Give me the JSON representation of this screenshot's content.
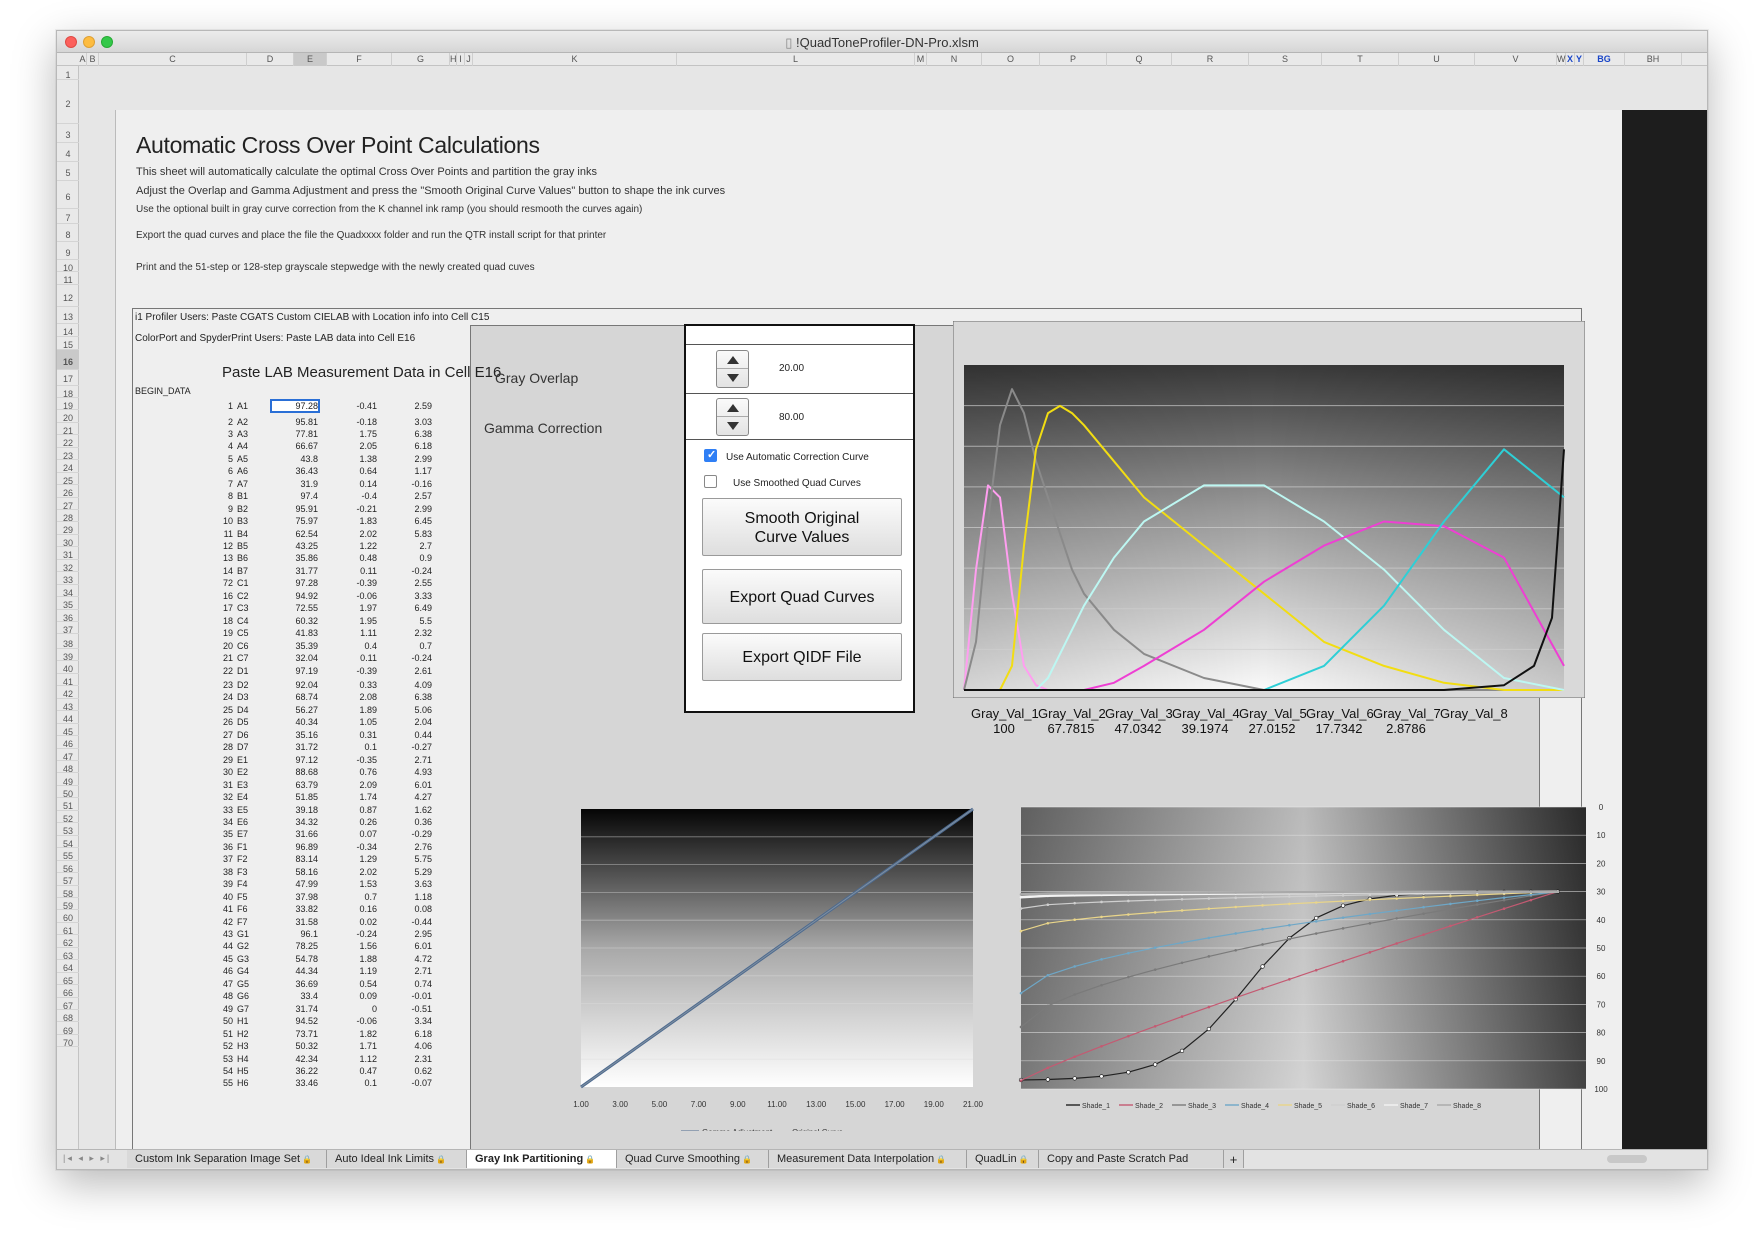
{
  "window": {
    "title": "!QuadToneProfiler-DN-Pro.xlsm"
  },
  "columns": [
    "A",
    "B",
    "C",
    "D",
    "E",
    "F",
    "G",
    "H",
    "I",
    "J",
    "K",
    "L",
    "M",
    "N",
    "O",
    "P",
    "Q",
    "R",
    "S",
    "T",
    "U",
    "V",
    "W",
    "X",
    "Y",
    "BG",
    "BH"
  ],
  "rows": [
    "1",
    "2",
    "3",
    "4",
    "5",
    "6",
    "7",
    "8",
    "9",
    "10",
    "11",
    "12",
    "13",
    "14",
    "15",
    "16",
    "17",
    "18",
    "19",
    "20",
    "21",
    "22",
    "23",
    "24",
    "25",
    "26",
    "27",
    "28",
    "29",
    "30",
    "31",
    "32",
    "33",
    "34",
    "35",
    "36",
    "37",
    "38",
    "39",
    "40",
    "41",
    "42",
    "43",
    "44",
    "45",
    "46",
    "47",
    "48",
    "49",
    "50",
    "51",
    "52",
    "53",
    "54",
    "55",
    "56",
    "57",
    "58",
    "59",
    "60",
    "61",
    "62",
    "63",
    "64",
    "65",
    "66",
    "67",
    "68",
    "69",
    "70"
  ],
  "page": {
    "title": "Automatic Cross Over Point Calculations",
    "lines": [
      "This sheet will automatically calculate the optimal Cross Over Points and partition the gray inks",
      "Adjust the Overlap and Gamma Adjustment and press the \"Smooth Original Curve Values\" button to shape the ink curves",
      "Use the optional built in gray curve correction from the K channel ink ramp (you should resmooth the curves again)",
      "Export the quad curves and place the file the Quadxxxx folder and run the QTR install script for that printer",
      "Print and the 51-step or 128-step grayscale stepwedge with the newly created quad cuves"
    ],
    "i1_note": "i1 Profiler Users: Paste CGATS Custom CIELAB with Location info into Cell C15",
    "colorport_note": "ColorPort and SpyderPrint Users: Paste LAB data into Cell E16",
    "paste_header": "Paste LAB Measurement Data in Cell E16",
    "begin_data": "BEGIN_DATA"
  },
  "lab_data": [
    [
      "1",
      "A1",
      "97.28",
      "-0.41",
      "2.59"
    ],
    [
      "2",
      "A2",
      "95.81",
      "-0.18",
      "3.03"
    ],
    [
      "3",
      "A3",
      "77.81",
      "1.75",
      "6.38"
    ],
    [
      "4",
      "A4",
      "66.67",
      "2.05",
      "6.18"
    ],
    [
      "5",
      "A5",
      "43.8",
      "1.38",
      "2.99"
    ],
    [
      "6",
      "A6",
      "36.43",
      "0.64",
      "1.17"
    ],
    [
      "7",
      "A7",
      "31.9",
      "0.14",
      "-0.16"
    ],
    [
      "8",
      "B1",
      "97.4",
      "-0.4",
      "2.57"
    ],
    [
      "9",
      "B2",
      "95.91",
      "-0.21",
      "2.99"
    ],
    [
      "10",
      "B3",
      "75.97",
      "1.83",
      "6.45"
    ],
    [
      "11",
      "B4",
      "62.54",
      "2.02",
      "5.83"
    ],
    [
      "12",
      "B5",
      "43.25",
      "1.22",
      "2.7"
    ],
    [
      "13",
      "B6",
      "35.86",
      "0.48",
      "0.9"
    ],
    [
      "14",
      "B7",
      "31.77",
      "0.11",
      "-0.24"
    ],
    [
      "72",
      "C1",
      "97.28",
      "-0.39",
      "2.55"
    ],
    [
      "16",
      "C2",
      "94.92",
      "-0.06",
      "3.33"
    ],
    [
      "17",
      "C3",
      "72.55",
      "1.97",
      "6.49"
    ],
    [
      "18",
      "C4",
      "60.32",
      "1.95",
      "5.5"
    ],
    [
      "19",
      "C5",
      "41.83",
      "1.11",
      "2.32"
    ],
    [
      "20",
      "C6",
      "35.39",
      "0.4",
      "0.7"
    ],
    [
      "21",
      "C7",
      "32.04",
      "0.11",
      "-0.24"
    ],
    [
      "22",
      "D1",
      "97.19",
      "-0.39",
      "2.61"
    ],
    [
      "23",
      "D2",
      "92.04",
      "0.33",
      "4.09"
    ],
    [
      "24",
      "D3",
      "68.74",
      "2.08",
      "6.38"
    ],
    [
      "25",
      "D4",
      "56.27",
      "1.89",
      "5.06"
    ],
    [
      "26",
      "D5",
      "40.34",
      "1.05",
      "2.04"
    ],
    [
      "27",
      "D6",
      "35.16",
      "0.31",
      "0.44"
    ],
    [
      "28",
      "D7",
      "31.72",
      "0.1",
      "-0.27"
    ],
    [
      "29",
      "E1",
      "97.12",
      "-0.35",
      "2.71"
    ],
    [
      "30",
      "E2",
      "88.68",
      "0.76",
      "4.93"
    ],
    [
      "31",
      "E3",
      "63.79",
      "2.09",
      "6.01"
    ],
    [
      "32",
      "E4",
      "51.85",
      "1.74",
      "4.27"
    ],
    [
      "33",
      "E5",
      "39.18",
      "0.87",
      "1.62"
    ],
    [
      "34",
      "E6",
      "34.32",
      "0.26",
      "0.36"
    ],
    [
      "35",
      "E7",
      "31.66",
      "0.07",
      "-0.29"
    ],
    [
      "36",
      "F1",
      "96.89",
      "-0.34",
      "2.76"
    ],
    [
      "37",
      "F2",
      "83.14",
      "1.29",
      "5.75"
    ],
    [
      "38",
      "F3",
      "58.16",
      "2.02",
      "5.29"
    ],
    [
      "39",
      "F4",
      "47.99",
      "1.53",
      "3.63"
    ],
    [
      "40",
      "F5",
      "37.98",
      "0.7",
      "1.18"
    ],
    [
      "41",
      "F6",
      "33.82",
      "0.16",
      "0.08"
    ],
    [
      "42",
      "F7",
      "31.58",
      "0.02",
      "-0.44"
    ],
    [
      "43",
      "G1",
      "96.1",
      "-0.24",
      "2.95"
    ],
    [
      "44",
      "G2",
      "78.25",
      "1.56",
      "6.01"
    ],
    [
      "45",
      "G3",
      "54.78",
      "1.88",
      "4.72"
    ],
    [
      "46",
      "G4",
      "44.34",
      "1.19",
      "2.71"
    ],
    [
      "47",
      "G5",
      "36.69",
      "0.54",
      "0.74"
    ],
    [
      "48",
      "G6",
      "33.4",
      "0.09",
      "-0.01"
    ],
    [
      "49",
      "G7",
      "31.74",
      "0",
      "-0.51"
    ],
    [
      "50",
      "H1",
      "94.52",
      "-0.06",
      "3.34"
    ],
    [
      "51",
      "H2",
      "73.71",
      "1.82",
      "6.18"
    ],
    [
      "52",
      "H3",
      "50.32",
      "1.71",
      "4.06"
    ],
    [
      "53",
      "H4",
      "42.34",
      "1.12",
      "2.31"
    ],
    [
      "54",
      "H5",
      "36.22",
      "0.47",
      "0.62"
    ],
    [
      "55",
      "H6",
      "33.46",
      "0.1",
      "-0.07"
    ]
  ],
  "controls": {
    "gray_overlap_label": "Gray Overlap",
    "gray_overlap_value": "20.00",
    "gamma_label": "Gamma Correction",
    "gamma_value": "80.00",
    "auto_curve_label": "Use Automatic Correction Curve",
    "auto_curve_checked": true,
    "smoothed_label": "Use Smoothed Quad Curves",
    "smoothed_checked": false,
    "smooth_btn_line1": "Smooth Original",
    "smooth_btn_line2": "Curve Values",
    "export_quad_btn": "Export Quad Curves",
    "export_qidf_btn": "Export QIDF File"
  },
  "gray_vals": [
    {
      "name": "Gray_Val_1",
      "value": "100"
    },
    {
      "name": "Gray_Val_2",
      "value": "67.7815"
    },
    {
      "name": "Gray_Val_3",
      "value": "47.0342"
    },
    {
      "name": "Gray_Val_4",
      "value": "39.1974"
    },
    {
      "name": "Gray_Val_5",
      "value": "27.0152"
    },
    {
      "name": "Gray_Val_6",
      "value": "17.7342"
    },
    {
      "name": "Gray_Val_7",
      "value": "2.8786"
    },
    {
      "name": "Gray_Val_8",
      "value": ""
    }
  ],
  "chart_data": [
    {
      "type": "line",
      "title": "",
      "xlabel": "",
      "ylabel": "",
      "series": [
        {
          "color": "#ff9ef0",
          "x": [
            0,
            2,
            4,
            6,
            8,
            10,
            12,
            14,
            16,
            18,
            20,
            25,
            30,
            40,
            50,
            60,
            70,
            80,
            90,
            100
          ],
          "y": [
            0,
            50,
            85,
            80,
            40,
            10,
            2,
            0,
            0,
            0,
            0,
            0,
            0,
            0,
            0,
            0,
            0,
            0,
            0,
            0
          ]
        },
        {
          "color": "#8a8a8a",
          "x": [
            0,
            2,
            4,
            6,
            8,
            10,
            12,
            14,
            16,
            18,
            20,
            25,
            30,
            40,
            50,
            60,
            70,
            80,
            90,
            100
          ],
          "y": [
            0,
            20,
            70,
            110,
            125,
            115,
            95,
            80,
            65,
            50,
            40,
            25,
            15,
            5,
            0,
            0,
            0,
            0,
            0,
            0
          ]
        },
        {
          "color": "#f2dd12",
          "x": [
            0,
            2,
            4,
            6,
            8,
            10,
            12,
            14,
            16,
            18,
            20,
            25,
            30,
            40,
            50,
            60,
            70,
            80,
            90,
            100
          ],
          "y": [
            0,
            0,
            0,
            0,
            10,
            60,
            100,
            115,
            118,
            115,
            110,
            95,
            80,
            60,
            40,
            20,
            10,
            3,
            0,
            0
          ]
        },
        {
          "color": "#bdf7f2",
          "x": [
            0,
            2,
            4,
            6,
            8,
            10,
            12,
            14,
            16,
            18,
            20,
            25,
            30,
            40,
            50,
            60,
            70,
            80,
            90,
            100
          ],
          "y": [
            0,
            0,
            0,
            0,
            0,
            0,
            0,
            5,
            15,
            25,
            35,
            55,
            70,
            85,
            85,
            70,
            50,
            25,
            5,
            0
          ]
        },
        {
          "color": "#ee3fd3",
          "x": [
            0,
            2,
            4,
            6,
            8,
            10,
            12,
            14,
            16,
            18,
            20,
            25,
            30,
            40,
            50,
            60,
            70,
            80,
            90,
            100
          ],
          "y": [
            0,
            0,
            0,
            0,
            0,
            0,
            0,
            0,
            0,
            0,
            0,
            3,
            10,
            25,
            45,
            60,
            70,
            68,
            55,
            10
          ]
        },
        {
          "color": "#2ecfd6",
          "x": [
            0,
            2,
            4,
            6,
            8,
            10,
            12,
            14,
            16,
            18,
            20,
            25,
            30,
            40,
            50,
            60,
            70,
            80,
            90,
            100
          ],
          "y": [
            0,
            0,
            0,
            0,
            0,
            0,
            0,
            0,
            0,
            0,
            0,
            0,
            0,
            0,
            0,
            10,
            35,
            70,
            100,
            80
          ]
        },
        {
          "color": "#111111",
          "x": [
            0,
            50,
            70,
            80,
            90,
            95,
            98,
            100
          ],
          "y": [
            0,
            0,
            0,
            0,
            2,
            10,
            30,
            100
          ]
        }
      ]
    },
    {
      "type": "line",
      "x_ticks": [
        "1.00",
        "3.00",
        "5.00",
        "7.00",
        "9.00",
        "11.00",
        "13.00",
        "15.00",
        "17.00",
        "19.00",
        "21.00"
      ],
      "legend": [
        "Gamma Adjustment",
        "Original Curve"
      ]
    },
    {
      "type": "line",
      "y_ticks": [
        "0",
        "10",
        "20",
        "30",
        "40",
        "50",
        "60",
        "70",
        "80",
        "90",
        "100"
      ],
      "legend": [
        "Shade_1",
        "Shade_2",
        "Shade_3",
        "Shade_4",
        "Shade_5",
        "Shade_6",
        "Shade_7",
        "Shade_8"
      ]
    }
  ],
  "tabs": [
    {
      "label": "Custom Ink Separation Image Set",
      "active": false
    },
    {
      "label": "Auto Ideal Ink Limits",
      "active": false
    },
    {
      "label": "Gray Ink Partitioning",
      "active": true
    },
    {
      "label": "Quad Curve Smoothing",
      "active": false
    },
    {
      "label": "Measurement Data Interpolation",
      "active": false
    },
    {
      "label": "QuadLin",
      "active": false
    },
    {
      "label": "Copy and Paste Scratch Pad",
      "active": false
    }
  ],
  "colors": {
    "accent": "#2f7ff5",
    "lock": "#8a6a2a"
  }
}
